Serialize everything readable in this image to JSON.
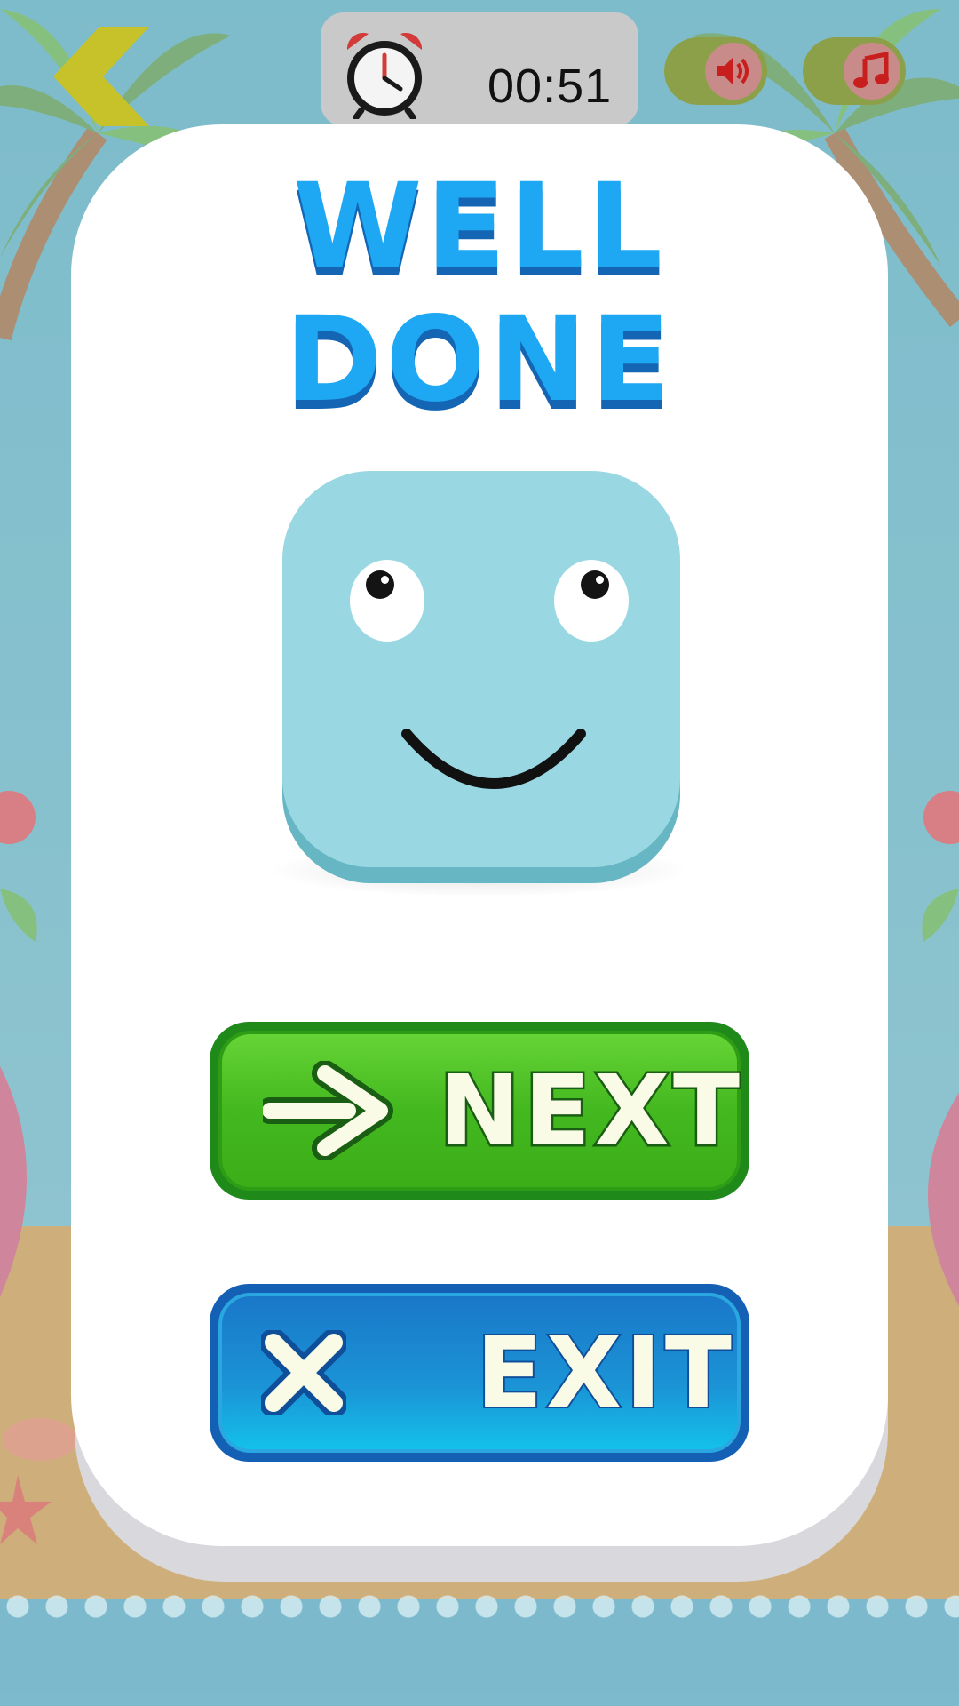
{
  "timer": {
    "value": "00:51",
    "icon": "alarm-clock-icon"
  },
  "top_bar": {
    "back_icon": "chevron-left-icon",
    "sound_icon": "speaker-icon",
    "music_icon": "music-note-icon"
  },
  "result": {
    "title_line1": "WELL",
    "title_line2": "DONE"
  },
  "buttons": {
    "next_label": "NEXT",
    "next_icon": "arrow-right-icon",
    "exit_label": "EXIT",
    "exit_icon": "close-icon"
  },
  "colors": {
    "title": "#1ea8f3",
    "next_button": "#43b81f",
    "exit_button": "#1b94d6",
    "face": "#99d8e3"
  }
}
